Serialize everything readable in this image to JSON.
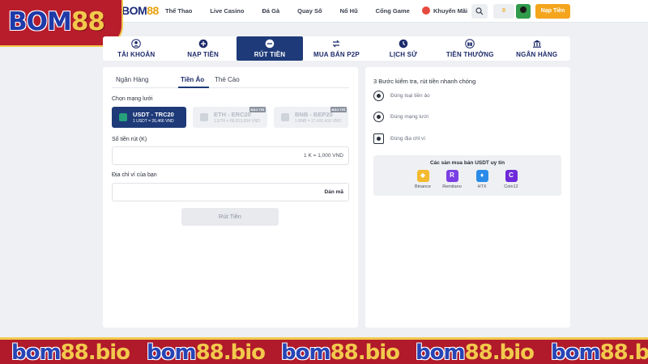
{
  "brand": {
    "logo_left": "B",
    "logo_mid": "OM",
    "logo_right": "88",
    "small_left": "B",
    "small_mid": "OM",
    "small_right": "88"
  },
  "nav": {
    "items": [
      "Thể Thao",
      "Live Casino",
      "Đá Gà",
      "Quay Số",
      "Nổ Hũ",
      "Cổng Game"
    ],
    "promo_label": "Khuyến Mãi",
    "balance": "0",
    "deposit_label": "Nạp Tiền"
  },
  "tabs": [
    {
      "label": "TÀI KHOẢN",
      "icon": "user-icon",
      "active": false
    },
    {
      "label": "NẠP TIỀN",
      "icon": "plus-circle-icon",
      "active": false
    },
    {
      "label": "RÚT TIỀN",
      "icon": "minus-circle-icon",
      "active": true
    },
    {
      "label": "MUA BÁN P2P",
      "icon": "transfer-icon",
      "active": false
    },
    {
      "label": "LỊCH SỬ",
      "icon": "clock-icon",
      "active": false
    },
    {
      "label": "TIỀN THƯỞNG",
      "icon": "gift-icon",
      "active": false
    },
    {
      "label": "NGÂN HÀNG",
      "icon": "bank-icon",
      "active": false
    }
  ],
  "withdraw": {
    "subtabs": [
      "Ngân Hàng",
      "Tiền Ảo",
      "Thẻ Cào"
    ],
    "active_subtab": "Tiền Ảo",
    "network_label": "Chọn mạng lưới",
    "networks": [
      {
        "name": "USDT - TRC20",
        "rate": "1 USDT = 26,466 VND",
        "badge": "",
        "state": "active"
      },
      {
        "name": "ETH - ERC20",
        "rate": "1 ETH = 68,813,654 VND",
        "badge": "BẢO TRÌ",
        "state": "disabled"
      },
      {
        "name": "BNB - BEP20",
        "rate": "1 BNB = 17,431,410 VND",
        "badge": "BẢO TRÌ",
        "state": "disabled"
      }
    ],
    "amount_label": "Số tiền rút (K)",
    "amount_hint": "1 K = 1,000 VND",
    "wallet_label": "Địa chỉ ví của bạn",
    "wallet_paste": "Dán mã",
    "submit_label": "Rút Tiền"
  },
  "guide": {
    "title": "3 Bước kiểm tra, rút tiền nhanh chóng",
    "steps": [
      "Đúng loại tiền ảo",
      "Đúng mạng lưới",
      "Đúng địa chỉ ví"
    ],
    "exchange_title": "Các sàn mua bán USDT uy tín",
    "exchanges": [
      {
        "name": "Binance",
        "color": "#f3ba2f",
        "glyph": "◆"
      },
      {
        "name": "Remitano",
        "color": "#7b3fe4",
        "glyph": "R"
      },
      {
        "name": "HTX",
        "color": "#2a8ce8",
        "glyph": "♦"
      },
      {
        "name": "Coin12",
        "color": "#6d2bd9",
        "glyph": "C"
      }
    ]
  },
  "footer": {
    "watermark_a": "bom",
    "watermark_b": "88.bio"
  }
}
